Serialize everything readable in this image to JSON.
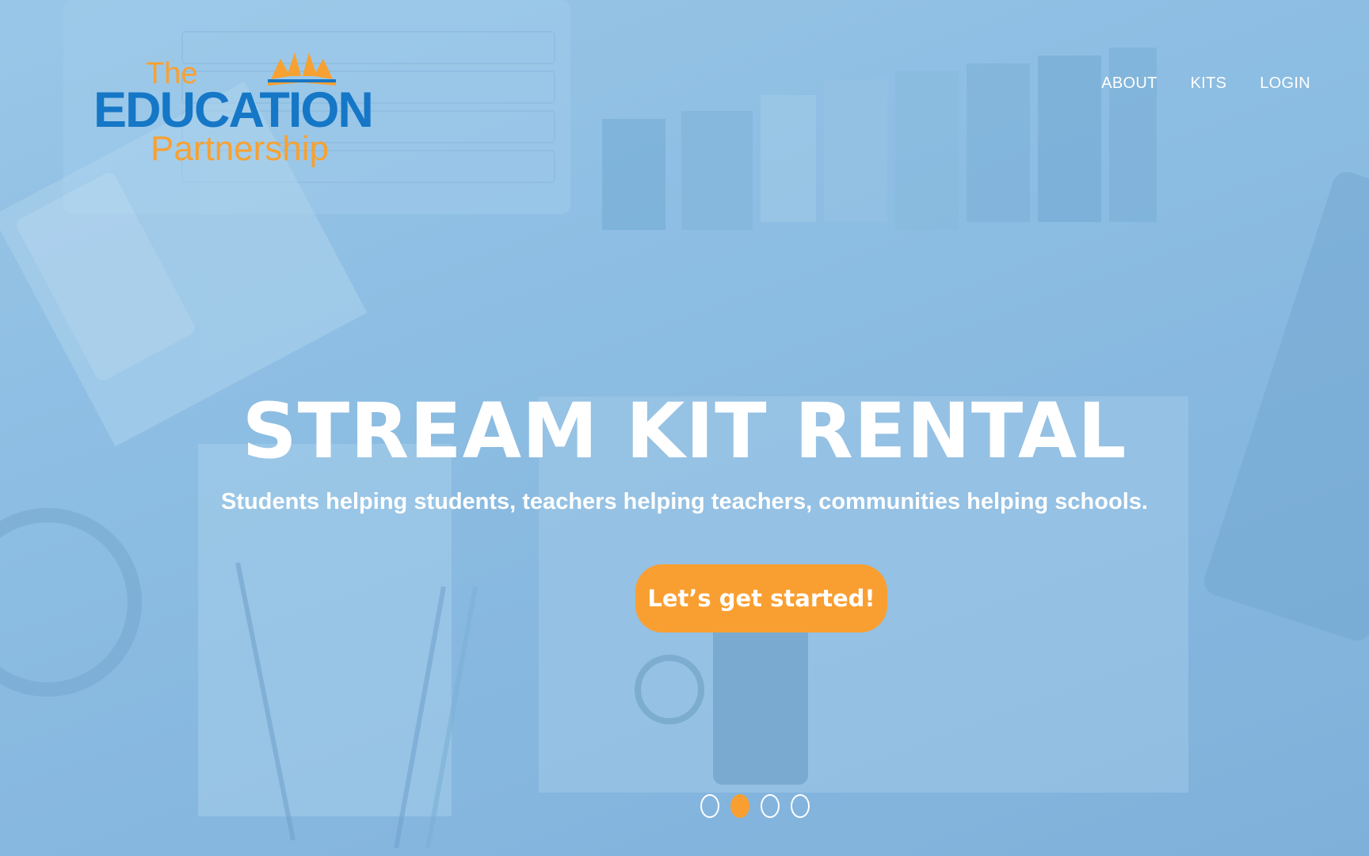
{
  "logo": {
    "line1": "The",
    "line2": "EDUCATION",
    "line3": "Partnership"
  },
  "nav": {
    "items": [
      {
        "label": "ABOUT"
      },
      {
        "label": "KITS"
      },
      {
        "label": "LOGIN"
      }
    ]
  },
  "hero": {
    "title": "STREAM KIT RENTAL",
    "subtitle": "Students helping students, teachers helping teachers, communities helping schools.",
    "cta_label": "Let’s get started!",
    "slides_total": 4,
    "active_slide": 2
  },
  "colors": {
    "overlay_blue": "#8fc0e3",
    "brand_orange": "#f99f31",
    "brand_blue": "#1577c6",
    "text": "#ffffff"
  },
  "icons": [
    "open-book-logo-icon"
  ]
}
